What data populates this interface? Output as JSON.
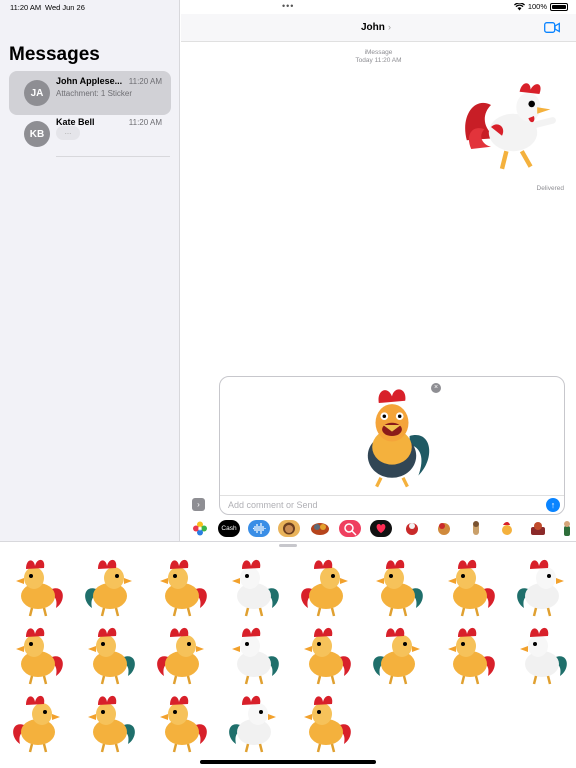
{
  "status_bar": {
    "time": "11:20 AM",
    "date": "Wed Jun 26",
    "battery": "100%"
  },
  "sidebar": {
    "title": "Messages",
    "conversations": [
      {
        "initials": "JA",
        "name": "John Applese...",
        "time": "11:20 AM",
        "preview": "Attachment: 1 Sticker"
      },
      {
        "initials": "KB",
        "name": "Kate Bell",
        "time": "11:20 AM",
        "preview": "..."
      }
    ]
  },
  "chat": {
    "title": "John",
    "service": "iMessage",
    "timestamp": "Today 11:20 AM",
    "status": "Delivered"
  },
  "compose": {
    "placeholder": "Add comment or Send",
    "close": "×",
    "send": "↑",
    "expand": "›"
  },
  "apps": [
    {
      "name": "photos-app-icon"
    },
    {
      "name": "apple-cash-app-icon",
      "label": "Cash"
    },
    {
      "name": "audio-app-icon"
    },
    {
      "name": "memoji-app-icon"
    },
    {
      "name": "animoji-app-icon"
    },
    {
      "name": "search-images-app-icon"
    },
    {
      "name": "digital-touch-app-icon"
    },
    {
      "name": "sticker-app-1-icon"
    },
    {
      "name": "sticker-app-2-icon"
    },
    {
      "name": "sticker-app-3-icon"
    },
    {
      "name": "sticker-app-4-icon"
    },
    {
      "name": "sticker-app-5-icon"
    },
    {
      "name": "sticker-app-6-icon"
    }
  ],
  "stickers_count": 21,
  "colors": {
    "accent": "#0a84ff",
    "rooster_red": "#d8202a",
    "rooster_body": "#f4b13d",
    "rooster_tail": "#1f6f6b"
  }
}
